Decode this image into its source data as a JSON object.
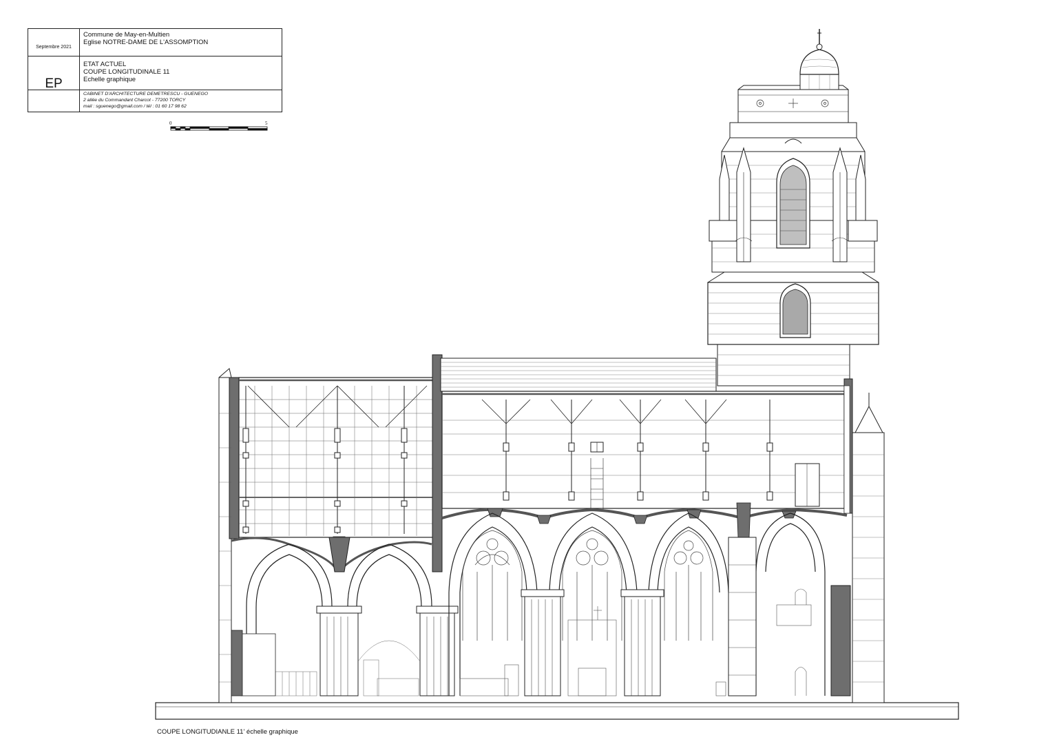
{
  "cartouche": {
    "date": "Septembre 2021",
    "commune": "Commune de May-en-Multien",
    "church": "Eglise NOTRE-DAME DE L'ASSOMPTION",
    "phase_code": "EP",
    "state": "ETAT ACTUEL",
    "drawing_title": "COUPE LONGITUDINALE 11",
    "scale_text": "Echelle graphique",
    "architect": "CABINET D'ARCHITECTURE DEMETRESCU - GUENEGO",
    "address": "2 allée du Commandant Charcot - 77200 TORCY",
    "contact": "mail : sguenego@gmail.com / tél : 01 60 17 98 62"
  },
  "scale_bar": {
    "start_label": "0",
    "end_label": "5"
  },
  "caption": "COUPE LONGITUDIANLE 11' échelle  graphique",
  "colors": {
    "line": "#222222",
    "fill_dark": "#6e6e6e",
    "fill_light": "#bfbfbf",
    "glass": "#a9a9a9"
  }
}
